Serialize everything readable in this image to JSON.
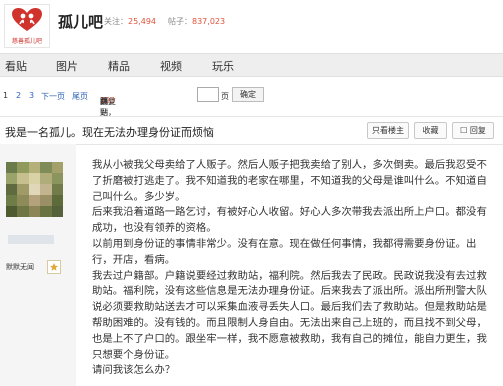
{
  "header": {
    "logo_text": "慈善孤儿吧",
    "title": "孤儿吧",
    "members_label": "关注：",
    "members": "25,494",
    "posts_label": "帖子：",
    "posts": "837,023"
  },
  "nav": {
    "tabs": [
      "看贴",
      "图片",
      "精品",
      "视频",
      "玩乐"
    ]
  },
  "pager": {
    "pages": [
      "1",
      "2",
      "3"
    ],
    "next": "下一页",
    "last": "尾页",
    "replies": "193",
    "replies_label": "回复贴，",
    "total_label": "共",
    "total_pages": "3",
    "pages_unit": "页，",
    "jump_label": "跳到",
    "page_unit": "页",
    "confirm": "确定"
  },
  "thread": {
    "title": "我是一名孤儿。现在无法办理身份证而烦恼",
    "buttons": [
      "只看楼主",
      "收藏",
      "回复"
    ]
  },
  "poster": {
    "label": "默默无闻"
  },
  "post": {
    "paragraphs": [
      "我从小被我父母卖给了人贩子。然后人贩子把我卖给了别人，多次倒卖。最后我忍受不了折磨被打逃走了。我不知道我的老家在哪里，不知道我的父母是谁叫什么。不知道自己叫什么。多少岁。",
      "后来我沿着道路一路乞讨，有被好心人收留。好心人多次带我去派出所上户口。都没有成功，也没有领养的资格。",
      "以前用到身份证的事情非常少。没有在意。现在做任何事情，我都得需要身份证。出行，开店，看病。",
      "我去过户籍部。户籍说要经过救助站，福利院。然后我去了民政。民政说我没有去过救助站。福利院，没有这些信息是无法办理身份证。后来我去了派出所。派出所刑警大队说必须要救助站送去才可以采集血液寻丢失人口。最后我们去了救助站。但是救助站是帮助困难的。没有钱的。而且限制人身自由。无法出来自己上班的，而且找不到父母，也是上不了户口的。跟坐牢一样，我不愿意被救助，我有自己的摊位，能自力更生，我只想要个身份证。",
      "请问我该怎么办？"
    ]
  },
  "colors": {
    "accent": "#e2523a",
    "link": "#2d64b3",
    "logo_red": "#d0322c"
  },
  "icons": [
    "heart-logo-icon",
    "rank-badge-icon"
  ]
}
